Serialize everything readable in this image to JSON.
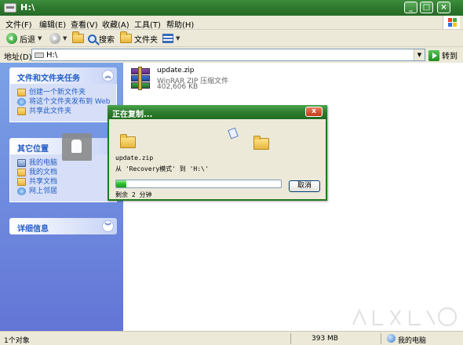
{
  "window": {
    "title": "H:\\"
  },
  "window_buttons": {
    "minimize": "_",
    "maximize": "□",
    "close": "×"
  },
  "menu": [
    "文件(F)",
    "编辑(E)",
    "查看(V)",
    "收藏(A)",
    "工具(T)",
    "帮助(H)"
  ],
  "toolbar": {
    "back": "后退",
    "search": "搜索",
    "folders": "文件夹"
  },
  "address": {
    "label": "地址(D)",
    "path": "H:\\",
    "go": "转到"
  },
  "tasks_panel": {
    "title": "文件和文件夹任务",
    "items": [
      "创建一个新文件夹",
      "将这个文件夹发布到 Web",
      "共享此文件夹"
    ]
  },
  "other_places": {
    "title": "其它位置",
    "items": [
      "我的电脑",
      "我的文档",
      "共享文档",
      "网上邻居"
    ]
  },
  "details": {
    "title": "详细信息"
  },
  "file": {
    "name": "update.zip",
    "type": "WinRAR ZIP 压缩文件",
    "size": "402,606 KB"
  },
  "dialog": {
    "title": "正在复制...",
    "close": "x",
    "filename": "update.zip",
    "from_to": "从 'Recovery模式' 到 'H:\\'",
    "progress": 0.06,
    "remaining": "剩余 2 分钟",
    "cancel": "取消"
  },
  "status": {
    "count": "1个对象",
    "size": "393 MB",
    "zone": "我的电脑"
  },
  "colors": {
    "title_green": "#2f7a2f",
    "taskpane_blue": "#6f8ee0",
    "link_blue": "#215dc6",
    "progress_green": "#2ebd2e"
  }
}
